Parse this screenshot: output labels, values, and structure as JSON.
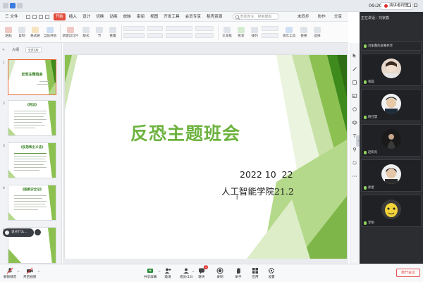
{
  "colors": {
    "accent": "#e24a3a",
    "green": "#6db33f",
    "dark_green": "#3e8a1d",
    "panel": "#2b2d31"
  },
  "system": {
    "clock": "09:20",
    "record_label": "演讲者视图"
  },
  "menu": {
    "file": "三 文件",
    "tabs": [
      "开始",
      "插入",
      "设计",
      "切换",
      "动画",
      "放映",
      "审阅",
      "视图",
      "开发工具",
      "会员专享",
      "稻壳资源"
    ],
    "search_placeholder": "查找命令、搜索模板",
    "right": [
      "未同步",
      "协作",
      "分享"
    ]
  },
  "ribbon": {
    "buttons": [
      "粘贴",
      "复制",
      "格式刷",
      "当前开始",
      "新建幻灯片",
      "版式",
      "节",
      "重置",
      "文本框",
      "形状",
      "排列",
      "演示工具",
      "替换",
      "选择"
    ]
  },
  "left_panel": {
    "tabs": [
      "大纲",
      "幻灯片"
    ],
    "slides": [
      {
        "num": "1",
        "title": "反恐主题班会"
      },
      {
        "num": "2",
        "title": "《刑法》"
      },
      {
        "num": "3",
        "title": "《反恐怖主义法》"
      },
      {
        "num": "4",
        "title": "《国家安全法》"
      },
      {
        "num": "5",
        "title": ""
      }
    ],
    "chat_placeholder": "说点什么..."
  },
  "slide": {
    "title": "反恐主题班会",
    "date": "2022 10  22",
    "subtitle": "人工智能学院21.2"
  },
  "participants": {
    "speaking_label": "正在讲话：",
    "speaking_name": "刘家鑫",
    "first_name": "刘家鑫的屏幕共享",
    "people": [
      {
        "name": "张磊"
      },
      {
        "name": "杨佳慧"
      },
      {
        "name": "赵阳光"
      },
      {
        "name": "徐星"
      },
      {
        "name": "李明"
      }
    ]
  },
  "toolbar": {
    "items": [
      "解除静音",
      "开启视频",
      "共享屏幕",
      "邀请",
      "成员(13)",
      "聊天",
      "录制",
      "举手",
      "应用",
      "设置"
    ],
    "leave": "离开会议",
    "chat_badge": "1"
  }
}
